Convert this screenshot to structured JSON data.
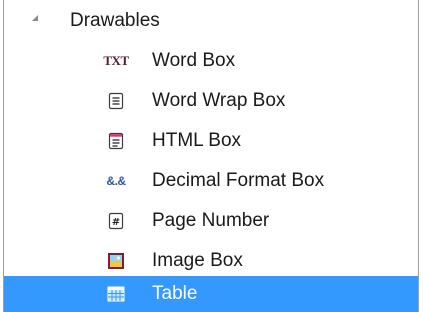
{
  "tree": {
    "group": {
      "label": "Drawables",
      "expander_icon": "triangle-expanded-icon"
    },
    "items": [
      {
        "label": "Word Box",
        "icon": "txt-icon",
        "icon_text": "TXT"
      },
      {
        "label": "Word Wrap Box",
        "icon": "text-document-icon"
      },
      {
        "label": "HTML Box",
        "icon": "html-document-icon"
      },
      {
        "label": "Decimal Format Box",
        "icon": "decimal-format-icon",
        "icon_text": "&.&"
      },
      {
        "label": "Page Number",
        "icon": "page-number-icon",
        "icon_text": "#"
      },
      {
        "label": "Image Box",
        "icon": "image-icon"
      },
      {
        "label": "Table",
        "icon": "table-grid-icon",
        "selected": true
      }
    ],
    "colors": {
      "selection": "#3399ff",
      "selected_text": "#ffffff",
      "border": "#a0a0a0"
    }
  }
}
